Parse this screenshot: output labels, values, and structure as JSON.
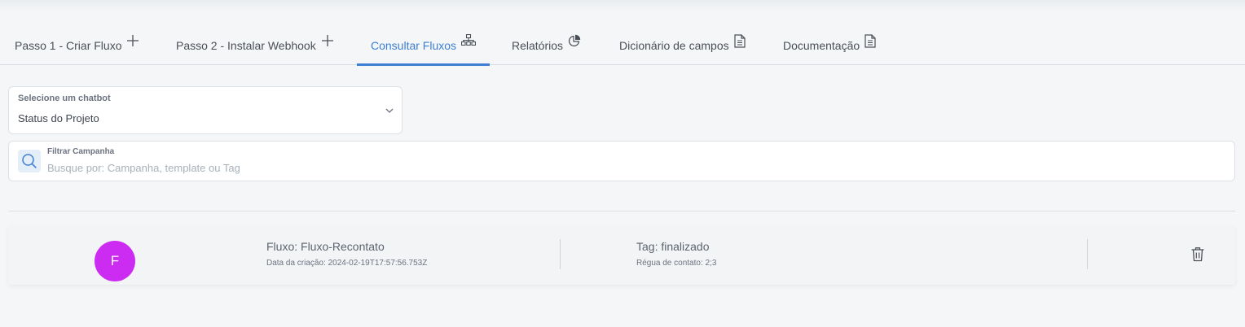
{
  "tabs": [
    {
      "label": "Passo 1 - Criar Fluxo",
      "icon": "plus-icon",
      "active": false
    },
    {
      "label": "Passo 2 - Instalar Webhook",
      "icon": "plus-icon",
      "active": false
    },
    {
      "label": "Consultar Fluxos",
      "icon": "sitemap-icon",
      "active": true
    },
    {
      "label": "Relatórios",
      "icon": "pie-chart-icon",
      "active": false
    },
    {
      "label": "Dicionário de campos",
      "icon": "document-icon",
      "active": false
    },
    {
      "label": "Documentação",
      "icon": "document-icon",
      "active": false
    }
  ],
  "colors": {
    "accent": "#3d7fd1",
    "avatar": "#cc2cf2"
  },
  "chatbot_select": {
    "caption": "Selecione um chatbot",
    "value": "Status do Projeto",
    "icon": "chevron-down-icon"
  },
  "search": {
    "caption": "Filtrar Campanha",
    "placeholder": "Busque por: Campanha, template ou Tag",
    "value": "",
    "icon": "search-icon"
  },
  "flows": [
    {
      "avatar_letter": "F",
      "flow_title": "Fluxo: Fluxo-Recontato",
      "created": "Data da criação: 2024-02-19T17:57:56.753Z",
      "tag": "Tag: finalizado",
      "rule": "Régua de contato: 2;3",
      "delete_icon": "trash-icon"
    }
  ]
}
